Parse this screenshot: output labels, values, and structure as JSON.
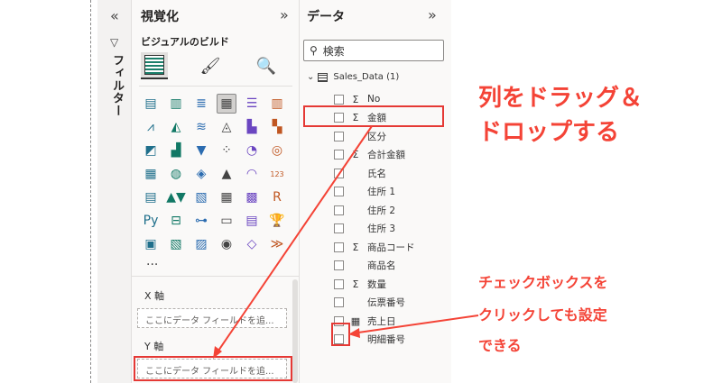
{
  "filters": {
    "collapse_glyph": "«",
    "label": "フィルター"
  },
  "visualizations": {
    "title": "視覚化",
    "collapse_glyph": "»",
    "subtitle": "ビジュアルのビルド",
    "tabs": [
      "build-visual-icon",
      "format-visual-icon",
      "analytics-icon"
    ],
    "icons": [
      "stacked-bar-icon",
      "stacked-column-icon",
      "clustered-bar-icon",
      "clustered-column-icon",
      "100-bar-icon",
      "100-column-icon",
      "line-icon",
      "area-icon",
      "stacked-area-icon",
      "ribbon-icon",
      "line-column-icon",
      "waterfall-icon",
      "ribbon-chart-icon",
      "column-line-icon",
      "funnel-icon",
      "scatter-icon",
      "pie-icon",
      "donut-icon",
      "treemap-icon",
      "map-icon",
      "filled-map-icon",
      "azure-map-icon",
      "gauge-icon",
      "card-icon",
      "multirow-card-icon",
      "kpi-icon",
      "slicer-icon",
      "table-icon",
      "matrix-icon",
      "r-visual-icon",
      "python-icon",
      "key-influencers-icon",
      "decomposition-tree-icon",
      "qa-icon",
      "narrative-icon",
      "goals-icon",
      "paginated-report-icon",
      "power-apps-icon",
      "power-automate-icon",
      "arcgis-icon",
      "powerapps-icon",
      "automate-icon"
    ],
    "icon_glyphs": [
      "▤",
      "▥",
      "≣",
      "▦",
      "☰",
      "▥",
      "⩘",
      "◭",
      "≋",
      "◬",
      "▙",
      "▚",
      "◩",
      "▟",
      "▼",
      "⁘",
      "◔",
      "◎",
      "▦",
      "◍",
      "◈",
      "▲",
      "◠",
      "123",
      "▤",
      "▲▼",
      "▧",
      "▦",
      "▩",
      "R",
      "Py",
      "⊟",
      "⊶",
      "▭",
      "▤",
      "🏆",
      "▣",
      "▧",
      "▨",
      "◉",
      "◇",
      "≫"
    ],
    "more": "...",
    "x_axis_label": "X 軸",
    "x_axis_placeholder": "ここにデータ フィールドを追...",
    "y_axis_label": "Y 軸",
    "y_axis_placeholder": "ここにデータ フィールドを追..."
  },
  "data_pane": {
    "title": "データ",
    "collapse_glyph": "»",
    "search_placeholder": "検索",
    "table_name": "Sales_Data (1)",
    "fields": [
      {
        "name": "No",
        "sigma": "Σ"
      },
      {
        "name": "金額",
        "sigma": "Σ"
      },
      {
        "name": "区分",
        "sigma": ""
      },
      {
        "name": "合計金額",
        "sigma": "Σ"
      },
      {
        "name": "氏名",
        "sigma": ""
      },
      {
        "name": "住所 1",
        "sigma": ""
      },
      {
        "name": "住所 2",
        "sigma": ""
      },
      {
        "name": "住所 3",
        "sigma": ""
      },
      {
        "name": "商品コード",
        "sigma": "Σ"
      },
      {
        "name": "商品名",
        "sigma": ""
      },
      {
        "name": "数量",
        "sigma": "Σ"
      },
      {
        "name": "伝票番号",
        "sigma": ""
      },
      {
        "name": "売上日",
        "sigma": "▦"
      },
      {
        "name": "明細番号",
        "sigma": ""
      }
    ]
  },
  "annotations": {
    "drag_line1": "列をドラッグ＆",
    "drag_line2": "ドロップする",
    "check_line1": "チェックボックスを",
    "check_line2": "クリックしても設定",
    "check_line3": "できる",
    "color": "#f44336"
  }
}
